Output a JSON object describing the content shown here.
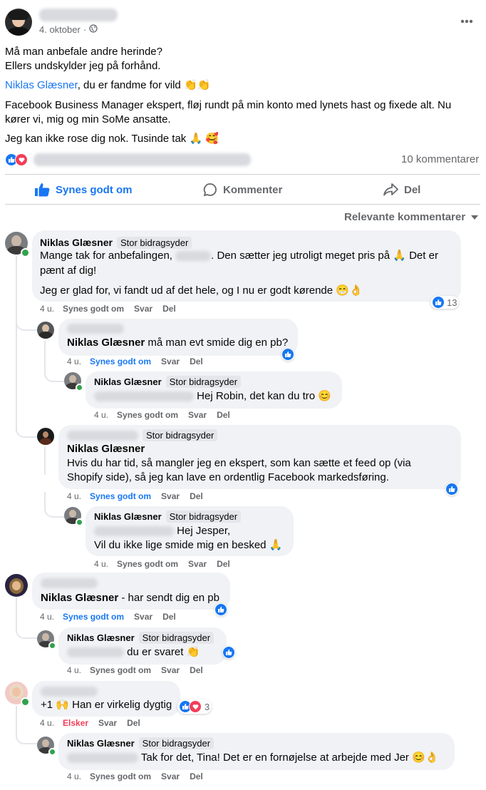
{
  "post": {
    "date": "4. oktober",
    "privacy_separator": "·",
    "line1": "Må man anbefale andre herinde?",
    "line2": "Ellers undskylder jeg på forhånd.",
    "mention": "Niklas Glæsner",
    "mention_rest": ", du er fandme for vild 👏👏",
    "line4a": "Facebook Business Manager ekspert, fløj rundt på min konto med lynets hast og fixede alt. Nu",
    "line4b": "kører vi, mig og min SoMe ansatte.",
    "line5": "Jeg kan ikke rose dig nok. Tusinde tak 🙏 🥰",
    "comment_count": "10 kommentarer",
    "more_icon": "more-dots-icon"
  },
  "actions": {
    "like": "Synes godt om",
    "comment": "Kommenter",
    "share": "Del"
  },
  "sort": {
    "label": "Relevante kommentarer"
  },
  "colors": {
    "accent": "#1877f2",
    "love": "#f33e58",
    "online": "#31a24c",
    "bubble": "#f0f2f5"
  },
  "labels": {
    "like": "Synes godt om",
    "reply": "Svar",
    "share": "Del",
    "love": "Elsker",
    "badge": "Stor bidragsyder"
  },
  "comments": [
    {
      "name": "Niklas Glæsner",
      "badge": "Stor bidragsyder",
      "line1a": "Mange tak for anbefalingen,",
      "line1b": ". Den sætter jeg utroligt meget pris på 🙏 Det er",
      "line2": "pænt af dig!",
      "line3": "Jeg er glad for, vi fandt ud af det hele, og I nu er godt kørende 😁👌",
      "time": "4 u.",
      "reactions": "13"
    },
    {
      "name": "Niklas Glæsner",
      "text": " må man evt smide dig en pb?",
      "time": "4 u."
    },
    {
      "name": "Niklas Glæsner",
      "badge": "Stor bidragsyder",
      "text": "Hej Robin, det kan du tro 😊",
      "time": "4 u."
    },
    {
      "badge": "Stor bidragsyder",
      "name": "Niklas Glæsner",
      "line1": "Hvis du har tid, så mangler jeg en ekspert, som kan sætte et feed op (via",
      "line2": "Shopify side), så jeg kan lave en ordentlig Facebook markedsføring.",
      "time": "4 u."
    },
    {
      "name": "Niklas Glæsner",
      "badge": "Stor bidragsyder",
      "line1": "Hej Jesper,",
      "line2": "Vil du ikke lige smide mig en besked 🙏",
      "time": "4 u."
    },
    {
      "name": "Niklas Glæsner",
      "text": " - har sendt dig en pb",
      "time": "4 u."
    },
    {
      "name": "Niklas Glæsner",
      "badge": "Stor bidragsyder",
      "text": "du er svaret 👏",
      "time": "4 u."
    },
    {
      "text": "+1 🙌 Han er virkelig dygtig",
      "time": "4 u.",
      "reactions": "3"
    },
    {
      "name": "Niklas Glæsner",
      "badge": "Stor bidragsyder",
      "text": "Tak for det, Tina! Det er en fornøjelse at arbejde med Jer 😊👌",
      "time": "4 u."
    }
  ]
}
